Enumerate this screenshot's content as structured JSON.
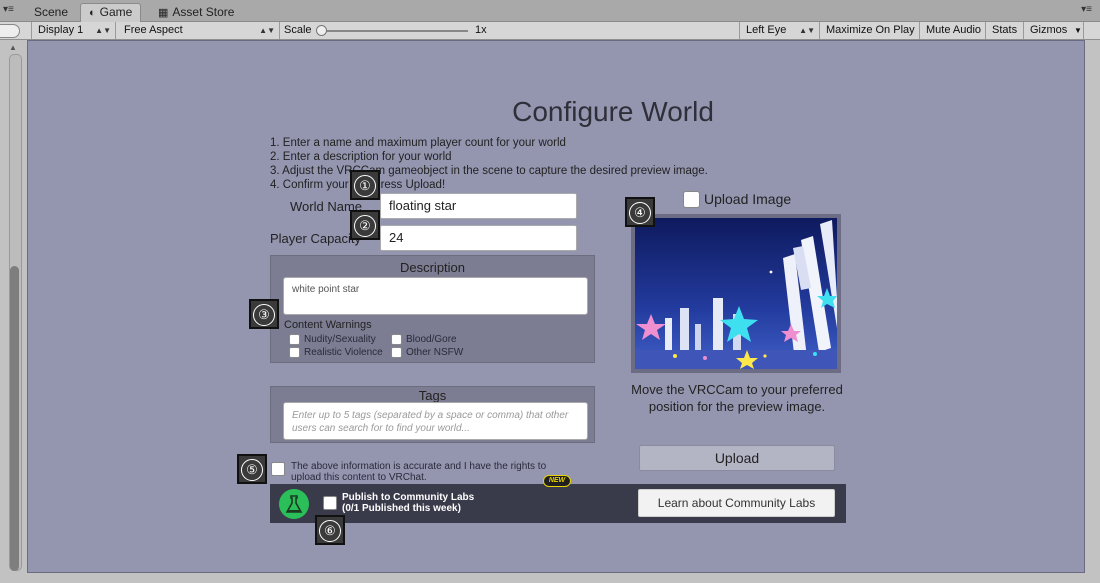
{
  "tabs": [
    {
      "label": "Scene",
      "icon": "scene-icon"
    },
    {
      "label": "Game",
      "icon": "game-controller-icon",
      "active": true
    },
    {
      "label": "Asset Store",
      "icon": "asset-store-icon"
    }
  ],
  "toolbar": {
    "display": "Display 1",
    "aspect": "Free Aspect",
    "scale_label": "Scale",
    "scale_value": "1x",
    "eye": "Left Eye",
    "maximize": "Maximize On Play",
    "mute": "Mute Audio",
    "stats": "Stats",
    "gizmos": "Gizmos"
  },
  "form": {
    "title": "Configure World",
    "instructions": [
      "1. Enter a name and maximum player count for your world",
      "2. Enter a description for your world",
      "3. Adjust the VRCCam gameobject in the scene to capture the desired preview image.",
      "4. Confirm your       and press Upload!"
    ],
    "world_name_label": "World Name",
    "world_name_value": "floating star",
    "capacity_label": "Player Capacity",
    "capacity_value": "24",
    "description_title": "Description",
    "description_value": "white point star",
    "content_warnings_label": "Content Warnings",
    "warnings": [
      "Nudity/Sexuality",
      "Blood/Gore",
      "Realistic Violence",
      "Other NSFW"
    ],
    "tags_title": "Tags",
    "tags_placeholder": "Enter up to 5 tags (separated by a space or comma) that other users can search for to find your world...",
    "upload_image_label": "Upload Image",
    "preview_caption": "Move the VRCCam to your preferred position for the preview image.",
    "upload_button": "Upload",
    "rights_text": "The above information is accurate and I have the rights to upload this content to VRChat.",
    "community": {
      "new_badge": "NEW",
      "publish_line1": "Publish to Community Labs",
      "publish_line2": "(0/1 Published this week)",
      "learn_button": "Learn about Community Labs"
    }
  },
  "callouts": [
    "①",
    "②",
    "③",
    "④",
    "⑤",
    "⑥"
  ],
  "colors": {
    "game_bg": "#9496b0",
    "panel_bg": "#7c7d92",
    "community_bg": "#3a3b4a",
    "lab_green": "#2bbf5a",
    "new_yellow": "#e8d200"
  }
}
